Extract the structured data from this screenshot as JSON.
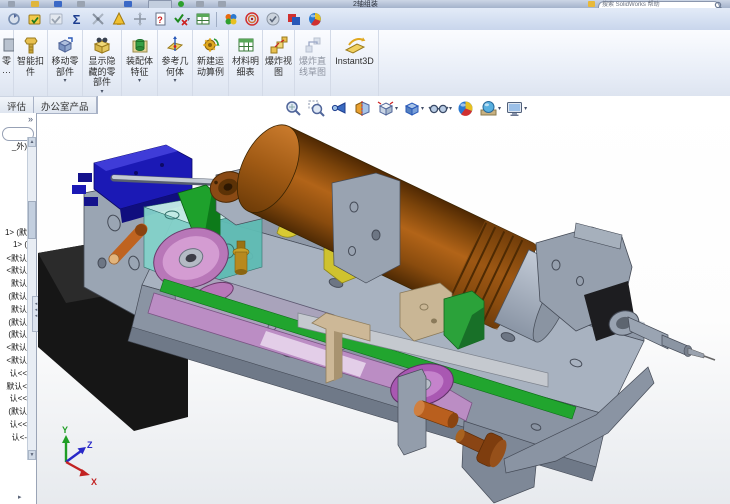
{
  "window": {
    "title": "2轴组装",
    "search_text": "搜索 SolidWorks 帮助"
  },
  "glyphs": {
    "panel_expand": "»",
    "splitter": "◂ ◂ ◂",
    "dropdown": "▾",
    "scroll_up": "▲",
    "scroll_down": "▼",
    "tree_more": "▸",
    "sigma": "Σ",
    "qmark": "?"
  },
  "tabs": {
    "evaluate": "评估",
    "office": "办公室产品"
  },
  "ribbon": {
    "buttons": [
      {
        "lines": [
          "零",
          "···"
        ]
      },
      {
        "lines": [
          "智能扣",
          "件"
        ]
      },
      {
        "lines": [
          "移动零",
          "部件"
        ]
      },
      {
        "lines": [
          "显示隐",
          "藏的零",
          "部件"
        ]
      },
      {
        "lines": [
          "装配体",
          "特征"
        ]
      },
      {
        "lines": [
          "参考几",
          "何体"
        ]
      },
      {
        "lines": [
          "新建运",
          "动算例"
        ]
      },
      {
        "lines": [
          "材料明",
          "细表"
        ]
      },
      {
        "lines": [
          "爆炸视",
          "图"
        ]
      },
      {
        "lines": [
          "爆炸直",
          "线草图"
        ]
      },
      {
        "lines": [
          "Instant3D"
        ]
      }
    ]
  },
  "tree": {
    "header": "_外)",
    "items": [
      "1> (默",
      "1> (",
      "<默认",
      "<默认",
      "默认",
      "(默认",
      "默认",
      "(默认",
      "(默认",
      "<默认",
      "<默认",
      "认<<",
      "默认<",
      "认<<",
      "(默认",
      "认<<",
      "认<-"
    ]
  },
  "triad": {
    "x": "X",
    "y": "Y",
    "z": "Z"
  },
  "colors": {
    "motor_brown": "#a05a14",
    "pulley_pink": "#c77fc4",
    "belt_purple": "#bb8dc4",
    "block_teal": "#7fd0c8",
    "plate_green": "#21a52e",
    "bracket_navy": "#1c1ab4",
    "bracket_yellow": "#d8ca33",
    "frame_gray": "#9aa5b3"
  }
}
